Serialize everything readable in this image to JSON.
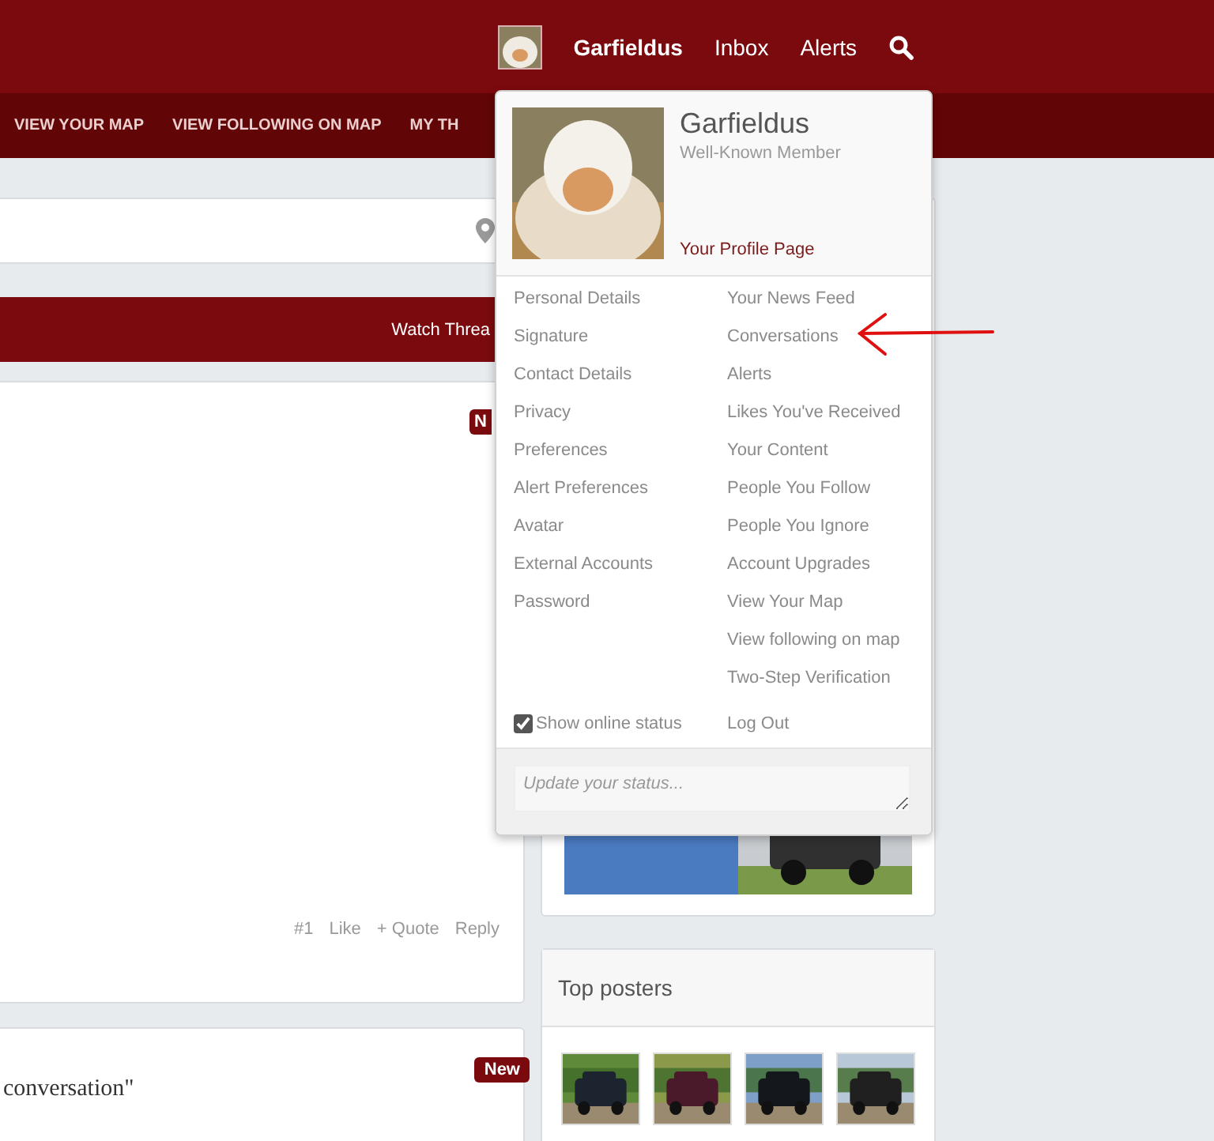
{
  "header": {
    "user_name": "Garfieldus",
    "links": [
      "Inbox",
      "Alerts"
    ]
  },
  "nav": {
    "items": [
      "VIEW YOUR MAP",
      "VIEW FOLLOWING ON MAP",
      "MY TH"
    ]
  },
  "thread_bar": {
    "button": "Watch Threa"
  },
  "posts": [
    {
      "badge": "N",
      "actions": [
        "#1",
        "Like",
        "+ Quote",
        "Reply"
      ]
    },
    {
      "badge": "New",
      "text": "conversation\""
    }
  ],
  "sidebar": {
    "top_posters": {
      "title": "Top posters"
    }
  },
  "account_menu": {
    "name": "Garfieldus",
    "role": "Well-Known Member",
    "profile_link": "Your Profile Page",
    "left_links": [
      "Personal Details",
      "Signature",
      "Contact Details",
      "Privacy",
      "Preferences",
      "Alert Preferences",
      "Avatar",
      "External Accounts",
      "Password"
    ],
    "right_links": [
      "Your News Feed",
      "Conversations",
      "Alerts",
      "Likes You've Received",
      "Your Content",
      "People You Follow",
      "People You Ignore",
      "Account Upgrades",
      "View Your Map",
      "View following on map",
      "Two-Step Verification"
    ],
    "online_status": {
      "label": "Show online status",
      "checked": true
    },
    "log_out": "Log Out",
    "status_placeholder": "Update your status..."
  }
}
